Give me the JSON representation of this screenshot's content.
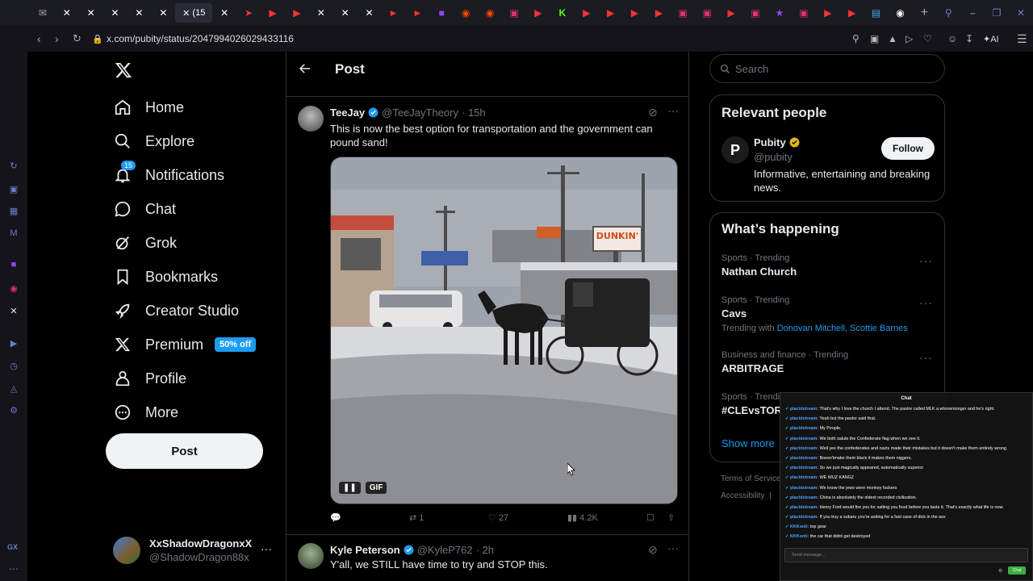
{
  "browser": {
    "tab_label": "(15",
    "url": "x.com/pubity/status/2047994026029433116",
    "ai_label": "AI",
    "gx_label": "GX"
  },
  "nav": {
    "items": [
      {
        "label": "Home",
        "icon": "home-icon"
      },
      {
        "label": "Explore",
        "icon": "search-icon"
      },
      {
        "label": "Notifications",
        "icon": "bell-icon",
        "badge": "15"
      },
      {
        "label": "Chat",
        "icon": "chat-icon"
      },
      {
        "label": "Grok",
        "icon": "grok-icon"
      },
      {
        "label": "Bookmarks",
        "icon": "bookmark-icon"
      },
      {
        "label": "Creator Studio",
        "icon": "rocket-icon"
      },
      {
        "label": "Premium",
        "icon": "x-logo-icon",
        "badge": "50% off"
      },
      {
        "label": "Profile",
        "icon": "person-icon"
      },
      {
        "label": "More",
        "icon": "more-circle-icon"
      }
    ],
    "post_button": "Post",
    "account": {
      "display_name": "XxShadowDragonxX",
      "handle": "@ShadowDragon88x"
    }
  },
  "header": {
    "title": "Post"
  },
  "tweets": [
    {
      "name": "TeeJay",
      "handle": "@TeeJayTheory",
      "time": "· 15h",
      "text": "This is now the best option for transportation and the government can pound sand!",
      "media": {
        "gif_label": "GIF",
        "sign": "DUNKIN'"
      },
      "actions": {
        "replies": "",
        "reposts": "1",
        "likes": "27",
        "views": "4.2K"
      }
    },
    {
      "name": "Kyle Peterson",
      "handle": "@KyleP762",
      "time": "· 2h",
      "text": "Y'all, we STILL have time to try and STOP this."
    }
  ],
  "search": {
    "placeholder": "Search"
  },
  "relevant": {
    "title": "Relevant people",
    "name": "Pubity",
    "handle": "@pubity",
    "follow": "Follow",
    "bio": "Informative, entertaining and breaking news."
  },
  "happening": {
    "title": "What’s happening",
    "trends": [
      {
        "category": "Sports · Trending",
        "name": "Nathan Church"
      },
      {
        "category": "Sports · Trending",
        "name": "Cavs",
        "with_label": "Trending with",
        "with_links": "Donovan Mitchell, Scottie Barnes"
      },
      {
        "category": "Business and finance · Trending",
        "name": "ARBITRAGE"
      },
      {
        "category": "Sports · Trendi",
        "name": "#CLEvsTOR"
      }
    ],
    "show_more": "Show more"
  },
  "footer": {
    "terms": "Terms of Service",
    "accessibility": "Accessibility"
  },
  "chat": {
    "title": "Chat",
    "lines": [
      {
        "user": "placidstream:",
        "msg": "That's why I love the church I attend. The pastor called MLK a whoremonger and he's right."
      },
      {
        "user": "placidstream:",
        "msg": "Yeah but the pastor said that."
      },
      {
        "user": "placidstream:",
        "msg": "My People."
      },
      {
        "user": "placidstream:",
        "msg": "We both salute the Confederate flag when we see it."
      },
      {
        "user": "placidstream:",
        "msg": "Well yes the confederates and nazis made their mistakes but it doesn't make them entirely wrong"
      },
      {
        "user": "placidstream:",
        "msg": "Boesn'tmake them black it makes them niggers."
      },
      {
        "user": "placidstream:",
        "msg": "So we just magically appeared, automatically superior"
      },
      {
        "user": "placidstream:",
        "msg": "WE WUZ KANGZ"
      },
      {
        "user": "placidstream:",
        "msg": "We know the jews were monkey fuckers"
      },
      {
        "user": "placidstream:",
        "msg": "China is absolutely the oldest recorded civilization."
      },
      {
        "user": "placidstream:",
        "msg": "Henry Ford would fire you for salting you food before you taste it. That's exactly what life is now."
      },
      {
        "user": "placidstream:",
        "msg": "If you buy a subaru you're asking for a fast case of dick in the ass"
      },
      {
        "user": "KKKonti:",
        "msg": "top gear"
      },
      {
        "user": "KKKonti:",
        "msg": "the car that didnt get destroyed"
      }
    ],
    "input_placeholder": "Send message...",
    "send_label": "Chat"
  },
  "colors": {
    "accent": "#1d9bf0",
    "bg": "#000000",
    "border": "#2f3336",
    "muted": "#71767b",
    "verified": "#1d9bf0",
    "gold": "#e2b719"
  }
}
